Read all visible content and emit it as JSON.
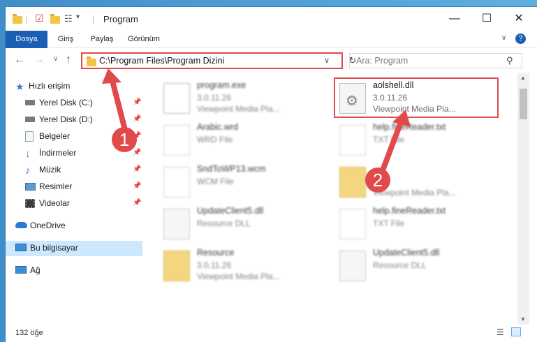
{
  "window": {
    "title": "Program"
  },
  "ribbon": {
    "tabs": [
      "Dosya",
      "Giriş",
      "Paylaş",
      "Görünüm"
    ]
  },
  "address": {
    "path": "C:\\Program Files\\Program Dizini"
  },
  "search": {
    "placeholder": "Ara: Program"
  },
  "sidebar": {
    "items": [
      {
        "label": "Hızlı erişim"
      },
      {
        "label": "Yerel Disk (C:)"
      },
      {
        "label": "Yerel Disk (D:)"
      },
      {
        "label": "Belgeler"
      },
      {
        "label": "İndirmeler"
      },
      {
        "label": "Müzik"
      },
      {
        "label": "Resimler"
      },
      {
        "label": "Videolar"
      },
      {
        "label": "OneDrive"
      },
      {
        "label": "Bu bilgisayar"
      },
      {
        "label": "Ağ"
      }
    ]
  },
  "files": [
    {
      "name": "program.exe",
      "l2": "3.0.11.26",
      "l3": "Viewpoint Media Pla..."
    },
    {
      "name": "aolshell.dll",
      "l2": "3.0.11.26",
      "l3": "Viewpoint Media Pla..."
    },
    {
      "name": "Arabic.wrd",
      "l2": "WRD File",
      "l3": ""
    },
    {
      "name": "help.fineReader.txt",
      "l2": "TXT File",
      "l3": ""
    },
    {
      "name": "SndToWP13.wcm",
      "l2": "WCM File",
      "l3": ""
    },
    {
      "name": "",
      "l2": "",
      "l3": "Viewpoint Media Pla..."
    },
    {
      "name": "UpdateClient5.dll",
      "l2": "Resource DLL",
      "l3": ""
    },
    {
      "name": "help.fineReader.txt",
      "l2": "TXT File",
      "l3": ""
    },
    {
      "name": "Resource",
      "l2": "3.0.11.26",
      "l3": "Viewpoint Media Pla..."
    },
    {
      "name": "UpdateClient5.dll",
      "l2": "Resource DLL",
      "l3": ""
    }
  ],
  "status": {
    "count": "132 öğe"
  },
  "annotations": {
    "one": "1",
    "two": "2"
  }
}
